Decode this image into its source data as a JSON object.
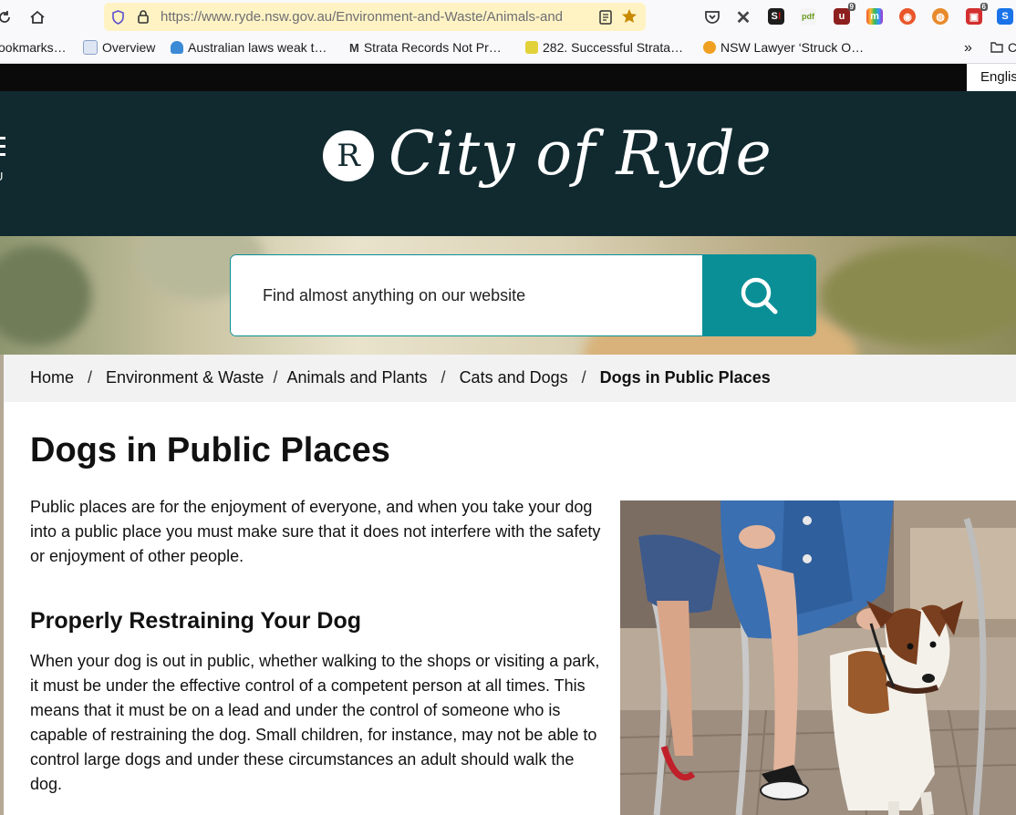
{
  "browser": {
    "url": "https://www.ryde.nsw.gov.au/Environment-and-Waste/Animals-and",
    "bookmarks": [
      "ookmarks…",
      "Overview",
      "Australian laws weak t…",
      "Strata Records Not Pr…",
      "282. Successful Strata…",
      "NSW Lawyer ‘Struck O…"
    ],
    "ext_badges": [
      "9",
      "6"
    ],
    "overflow_folder": "C"
  },
  "site": {
    "language": "English",
    "menu_letter": "U",
    "logo_letter": "R",
    "logo_text": "City of Ryde",
    "search_placeholder": "Find almost anything on our website",
    "breadcrumbs": [
      "Home",
      "Environment & Waste",
      "Animals and Plants",
      "Cats and Dogs"
    ],
    "breadcrumb_current": "Dogs in Public Places",
    "page_title": "Dogs in Public Places",
    "intro": "Public places are for the enjoyment of everyone, and when you take your dog into a public place you must make sure that it does not interfere with the safety or enjoyment of other people.",
    "section_heading": "Properly Restraining Your Dog",
    "section_body": "When your dog is out in public, whether walking to the shops or visiting a park, it must be under the effective control of a competent person at all times. This means that it must be on a lead and under the control of someone who is capable of restraining the dog. Small children, for instance, may not be able to control large dogs and under these circumstances an adult should walk the dog."
  },
  "colors": {
    "header_bg": "#112a30",
    "accent_teal": "#0b8f97",
    "url_highlight": "#fff3c4"
  }
}
